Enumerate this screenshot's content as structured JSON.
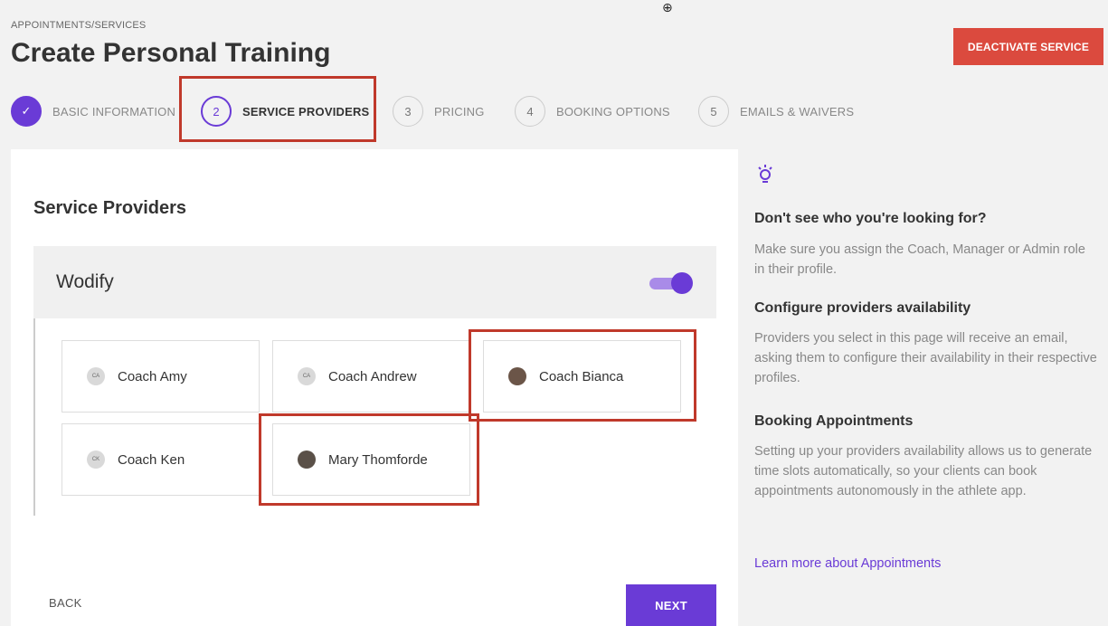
{
  "header": {
    "breadcrumb": "APPOINTMENTS/SERVICES",
    "title": "Create Personal Training",
    "deactivate_label": "DEACTIVATE SERVICE",
    "accent_color": "#6a3bd6",
    "danger_color": "#db4a3e"
  },
  "steps": [
    {
      "number": "✓",
      "label": "BASIC INFORMATION",
      "state": "done"
    },
    {
      "number": "2",
      "label": "SERVICE PROVIDERS",
      "state": "active"
    },
    {
      "number": "3",
      "label": "PRICING",
      "state": "pending"
    },
    {
      "number": "4",
      "label": "BOOKING OPTIONS",
      "state": "pending"
    },
    {
      "number": "5",
      "label": "EMAILS & WAIVERS",
      "state": "pending"
    }
  ],
  "main": {
    "section_title": "Service Providers",
    "group": {
      "name": "Wodify",
      "toggle_on": true
    },
    "providers": [
      {
        "initials": "CA",
        "name": "Coach Amy",
        "avatar": "initials"
      },
      {
        "initials": "CA",
        "name": "Coach Andrew",
        "avatar": "initials"
      },
      {
        "initials": "",
        "name": "Coach Bianca",
        "avatar": "photo"
      },
      {
        "initials": "CK",
        "name": "Coach Ken",
        "avatar": "initials"
      },
      {
        "initials": "",
        "name": "Mary Thomforde",
        "avatar": "photo"
      }
    ],
    "back_label": "BACK",
    "next_label": "NEXT"
  },
  "sidebar": {
    "icon": "lightbulb-icon",
    "tips": [
      {
        "heading": "Don't see who you're looking for?",
        "text": "Make sure you assign the Coach, Manager or Admin role in their profile."
      },
      {
        "heading": "Configure providers availability",
        "text": "Providers you select in this page will receive an email, asking them to configure their availability in their respective profiles."
      },
      {
        "heading": "Booking Appointments",
        "text": "Setting up your providers availability allows us to generate time slots automatically, so your clients can book appointments autonomously in the athlete app."
      }
    ],
    "link": "Learn more about Appointments"
  }
}
